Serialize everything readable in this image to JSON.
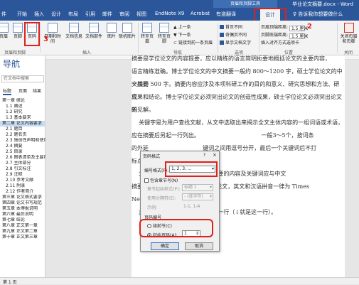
{
  "window": {
    "doc_title": "毕业论文摘要.docx - Word",
    "context_group": "页眉和页脚工具"
  },
  "tabs": [
    "件",
    "开始",
    "插入",
    "设计",
    "布局",
    "引用",
    "邮件",
    "审阅",
    "视图",
    "EndNote X9",
    "Acrobat",
    "有道翻译",
    "设计"
  ],
  "tell_me": "告诉我你想要做什么",
  "ribbon": {
    "hf_buttons": [
      "页眉",
      "页脚",
      "页码"
    ],
    "insert_buttons": [
      "日期和时间",
      "文档信息",
      "文档部件",
      "图片",
      "联机图片"
    ],
    "nav_buttons": [
      "转至页眉",
      "转至页脚"
    ],
    "nav_small": [
      "上一条",
      "下一条",
      "链接到前一条页眉"
    ],
    "options": [
      "首页不同",
      "奇偶页不同",
      "显示文档文字"
    ],
    "pos": {
      "header_label": "页眉顶端距离:",
      "header_val": "1.5 厘米",
      "footer_label": "页脚底端距离:",
      "footer_val": "1.5 厘米",
      "align_label": "插入对齐方式选项卡"
    },
    "close_label": "关闭页眉和页脚",
    "groups": [
      "页眉和页脚",
      "插入",
      "导航",
      "选项",
      "位置",
      "关闭"
    ],
    "annotations": [
      "2",
      "3"
    ]
  },
  "nav": {
    "title": "导航",
    "search": "在文档中搜索",
    "tabs": [
      "标题",
      "页面",
      "结果"
    ],
    "items": [
      "第一章 绪论",
      "1.1 阐述",
      "1.2 研究",
      "1.3 基本要求",
      "第二章 论文内容要求",
      "2.1 题目",
      "2.2 题名页",
      "2.3 独创性声明和使用",
      "2.4 摘要",
      "2.5 目录",
      "2.6 图表清单及主要符号",
      "2.7 主体部分",
      "2.8 引文标注",
      "2.9 注释",
      "2.10 参考文献",
      "2.11 附录",
      "2.12 作者简介",
      "第三章 论文格式要求",
      "第四章 论文书写规范",
      "第五章 本博报说明",
      "第六章 最后说明",
      "第七章 结论",
      "第八章 正文第一章",
      "第九章 正文第二章",
      "第十章 正文第三章"
    ]
  },
  "document": {
    "lines": [
      "摘要是学位论文的内容提要，应以精练的语言简明扼要地概括论文的主要内容，",
      "语言精练准确。博士学位论文的中文摘要一般约 800～1200 字，硕士学位论文的中文摘要",
      "一般约 500 字。摘要内容应涉及本项科研工作的目的和意义、研究思想和方法、研究",
      "成果和结论。博士学位论文必须突出论文的创造性成果，硕士学位论文必须突出论文的",
      "新见解。",
      "    关键字是为用户查找文献，从文中选取出来揭示全文主体内容的一组词语或术语，",
      "应在摘要后另起一行列出。                                  一般3～5个，按词条",
      "的外延                              键词之间用逗号分开，最后一个关键词后不打",
      "标点符号",
      "    为                            。英文摘要的内容及关键词应与中文",
      "摘要及关                            英文论文，英文和汉语拼音一律为 Times",
      "New Rom",
      "    对                            下方另起一行（↓就是这一行）。",
      "    关键"
    ]
  },
  "dialog": {
    "title": "页码格式",
    "help": "?",
    "close": "×",
    "number_format_label": "编号格式(F):",
    "number_format_value": "1, 2, 3, ...",
    "include_chapter_label": "包含章节号(N)",
    "chapter_style_label": "章节起始样式(P):",
    "chapter_style_value": "标题 1",
    "separator_label": "使用分隔符(E):",
    "separator_value": "- (连字符)",
    "example_label": "示例:",
    "example_value": "1-1, 1-A",
    "numbering_label": "页码编号",
    "continue_label": "续前节(C)",
    "start_at_label": "起始页码(A):",
    "start_at_value": "1",
    "ok": "确定",
    "cancel": "取消"
  },
  "status": {
    "text": "第 1 页"
  }
}
